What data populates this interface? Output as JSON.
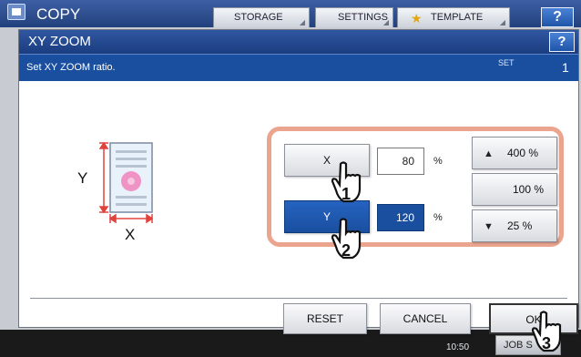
{
  "app": {
    "title": "COPY",
    "tabs": [
      {
        "label": "STORAGE"
      },
      {
        "label": "SETTINGS"
      },
      {
        "label": "TEMPLATE"
      }
    ],
    "help_label": "?",
    "clock": "10:50",
    "jobs_label": "JOB S"
  },
  "dialog": {
    "title": "XY ZOOM",
    "help_label": "?",
    "message": "Set XY ZOOM ratio.",
    "set_label": "SET",
    "set_number": "1"
  },
  "diagram": {
    "x_label": "X",
    "y_label": "Y"
  },
  "zoom": {
    "x_button": "X",
    "x_value": "80",
    "y_button": "Y",
    "y_value": "120",
    "unit": "%"
  },
  "presets": [
    {
      "label": "400 %",
      "icon": "up-triangle-icon"
    },
    {
      "label": "100 %"
    },
    {
      "label": "25 %",
      "icon": "down-triangle-icon"
    }
  ],
  "actions": {
    "reset": "RESET",
    "cancel": "CANCEL",
    "ok": "OK"
  },
  "steps": [
    "1",
    "2",
    "3"
  ]
}
